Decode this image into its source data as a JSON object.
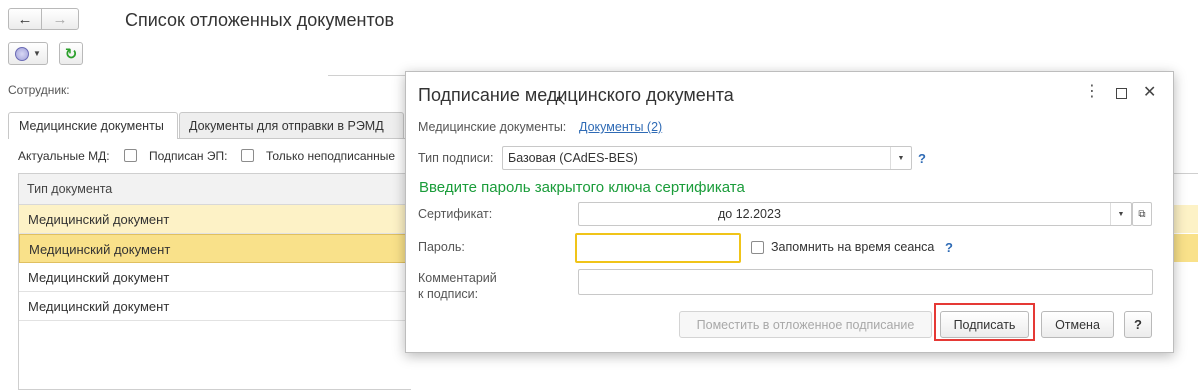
{
  "page": {
    "title": "Список отложенных документов",
    "employee_label": "Сотрудник:"
  },
  "tabs": [
    {
      "label": "Медицинские документы"
    },
    {
      "label": "Документы для отправки в РЭМД"
    }
  ],
  "filters": {
    "actual": "Актуальные МД:",
    "signed": "Подписан ЭП:",
    "unsigned": "Только неподписанные"
  },
  "table": {
    "header": "Тип документа",
    "rows": [
      "Медицинский документ",
      "Медицинский документ",
      "Медицинский документ",
      "Медицинский документ"
    ]
  },
  "dialog": {
    "title": "Подписание медицинского документа",
    "docs_label": "Медицинские документы:",
    "docs_link": "Документы (2)",
    "sign_type_label": "Тип подписи:",
    "sign_type_value": "Базовая (CAdES-BES)",
    "help": "?",
    "prompt": "Введите пароль закрытого ключа сертификата",
    "cert_label": "Сертификат:",
    "cert_value": "до 12.2023",
    "password_label": "Пароль:",
    "password_value": "",
    "remember_label": "Запомнить на время сеанса",
    "comment_label_1": "Комментарий",
    "comment_label_2": "к подписи:",
    "comment_value": "",
    "defer_button": "Поместить в отложенное подписание",
    "sign_button": "Подписать",
    "cancel_button": "Отмена",
    "help_button": "?"
  },
  "colors": {
    "accent_green": "#1a9c3a",
    "link_blue": "#2f6bb5",
    "row_highlight": "#fdf2c6",
    "row_selected": "#f9e18a",
    "highlight_border": "#e53935"
  }
}
